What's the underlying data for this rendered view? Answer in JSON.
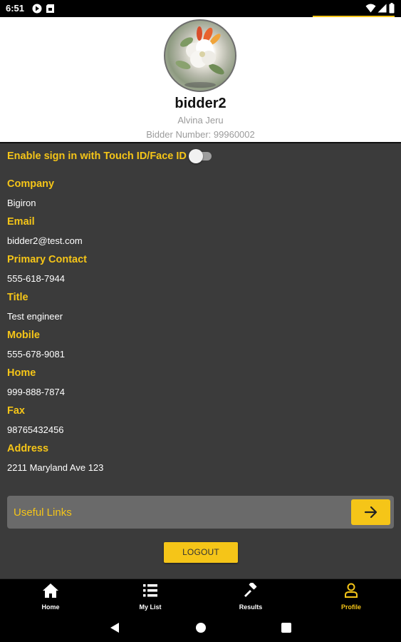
{
  "status_bar": {
    "time": "6:51",
    "left_icons": [
      "play-protect-icon",
      "card-icon"
    ],
    "right_icons": [
      "wifi-icon",
      "signal-icon",
      "battery-icon"
    ]
  },
  "profile": {
    "username": "bidder2",
    "full_name": "Alvina Jeru",
    "bidder_number": "Bidder Number: 99960002"
  },
  "biometric": {
    "label": "Enable sign in with Touch ID/Face ID",
    "enabled": false
  },
  "fields": [
    {
      "label": "Company",
      "value": "Bigiron"
    },
    {
      "label": "Email",
      "value": "bidder2@test.com"
    },
    {
      "label": "Primary Contact",
      "value": "555-618-7944"
    },
    {
      "label": "Title",
      "value": "Test engineer"
    },
    {
      "label": "Mobile",
      "value": "555-678-9081"
    },
    {
      "label": "Home",
      "value": "999-888-7874"
    },
    {
      "label": "Fax",
      "value": "98765432456"
    },
    {
      "label": "Address",
      "value": "2211 Maryland Ave 123"
    }
  ],
  "useful_links": {
    "label": "Useful Links"
  },
  "logout": {
    "label": "LOGOUT"
  },
  "bottom_nav": [
    {
      "label": "Home",
      "icon": "home-icon",
      "active": false
    },
    {
      "label": "My List",
      "icon": "list-icon",
      "active": false
    },
    {
      "label": "Results",
      "icon": "gavel-icon",
      "active": false
    },
    {
      "label": "Profile",
      "icon": "person-icon",
      "active": true
    }
  ],
  "colors": {
    "accent": "#f5c518",
    "background": "#3b3b3b",
    "header_bg": "#ffffff",
    "nav_bg": "#000000"
  }
}
